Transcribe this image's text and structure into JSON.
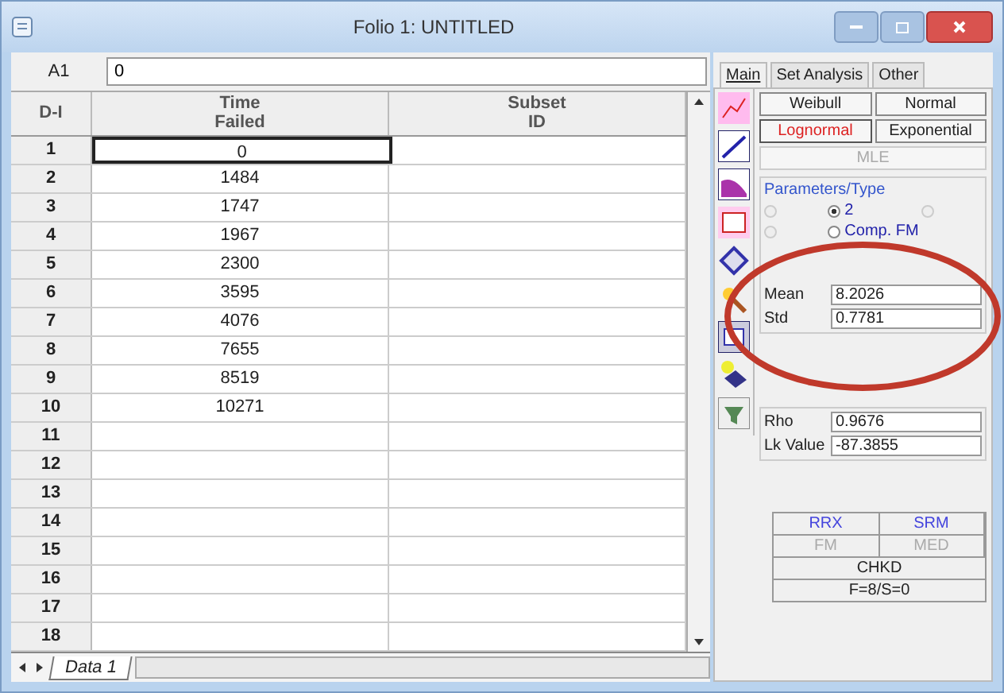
{
  "window": {
    "title": "Folio 1: UNTITLED"
  },
  "formula_bar": {
    "cell": "A1",
    "value": "0"
  },
  "table": {
    "corner": "D-I",
    "columns": [
      "Time\nFailed",
      "Subset\nID"
    ],
    "rows": [
      {
        "number": "1",
        "time": "0",
        "selected": true
      },
      {
        "number": "2",
        "time": "1484",
        "selected": false
      },
      {
        "number": "3",
        "time": "1747",
        "selected": false
      },
      {
        "number": "4",
        "time": "1967",
        "selected": false
      },
      {
        "number": "5",
        "time": "2300",
        "selected": false
      },
      {
        "number": "6",
        "time": "3595",
        "selected": false
      },
      {
        "number": "7",
        "time": "4076",
        "selected": false
      },
      {
        "number": "8",
        "time": "7655",
        "selected": false
      },
      {
        "number": "9",
        "time": "8519",
        "selected": false
      },
      {
        "number": "10",
        "time": "10271",
        "selected": false
      },
      {
        "number": "11",
        "selected": false
      },
      {
        "number": "12",
        "selected": false
      },
      {
        "number": "13",
        "selected": false
      },
      {
        "number": "14",
        "selected": false
      },
      {
        "number": "15",
        "selected": false
      },
      {
        "number": "16",
        "selected": false
      },
      {
        "number": "17",
        "selected": false
      },
      {
        "number": "18",
        "selected": false
      }
    ]
  },
  "sheet_tabs": [
    {
      "label": "Data 1",
      "selected": true
    }
  ],
  "panel": {
    "tabs": [
      {
        "label": "Main",
        "selected": true
      },
      {
        "label": "Set Analysis",
        "selected": false
      },
      {
        "label": "Other",
        "selected": false
      }
    ],
    "distributions": [
      {
        "label": "Weibull",
        "selected": false,
        "disabled": false
      },
      {
        "label": "Normal",
        "selected": false,
        "disabled": false
      },
      {
        "label": "Lognormal",
        "selected": true,
        "disabled": false
      },
      {
        "label": "Exponential",
        "selected": false,
        "disabled": false
      },
      {
        "label": "MLE",
        "selected": false,
        "disabled": true
      }
    ],
    "param_title": "Parameters/Type",
    "radios": [
      {
        "selected": false,
        "disabled": true
      },
      {
        "label": "2",
        "selected": true,
        "disabled": false
      },
      {
        "selected": false,
        "disabled": true
      },
      {
        "selected": false,
        "disabled": true
      },
      {
        "label": "Comp. FM",
        "selected": false,
        "disabled": false
      }
    ],
    "params": [
      {
        "label": "Mean",
        "value": "8.2026"
      },
      {
        "label": "Std",
        "value": "0.7781"
      }
    ],
    "fit": [
      {
        "label": "Rho",
        "value": "0.9676"
      },
      {
        "label": "Lk Value",
        "value": "-87.3855"
      }
    ],
    "methods": [
      {
        "label": "RRX",
        "disabled": false
      },
      {
        "label": "SRM",
        "disabled": false
      },
      {
        "label": "FM",
        "disabled": true
      },
      {
        "label": "MED",
        "disabled": true
      }
    ],
    "status": [
      "CHKD",
      "F=8/S=0"
    ]
  },
  "annotation": {
    "kind": "ellipse"
  }
}
